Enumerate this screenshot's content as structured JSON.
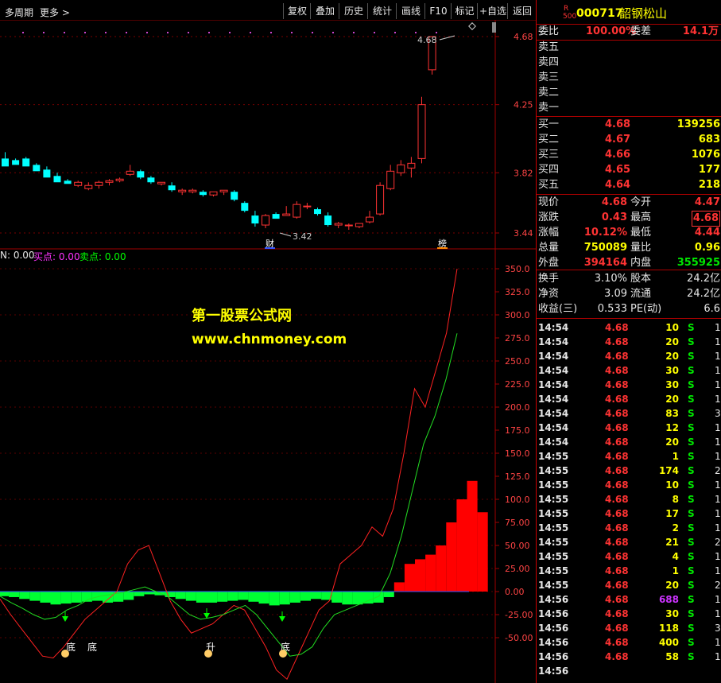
{
  "toolbar": {
    "period": "多周期",
    "more": "更多 >",
    "buttons": [
      "复权",
      "叠加",
      "历史",
      "统计",
      "画线",
      "F10",
      "标记",
      "+自选",
      "返回"
    ]
  },
  "stock": {
    "badge_top": "R",
    "badge_bottom": "500",
    "code": "000717",
    "name": "韶钢松山"
  },
  "watermark": {
    "line1": "第一股票公式网",
    "line2": "www.chnmoney.com"
  },
  "indicator_legend": {
    "n_label": "N: 0.00",
    "buy_label": "买点: 0.00",
    "sell_label": "卖点: 0.00"
  },
  "price_axis": [
    "4.68",
    "4.25",
    "3.82",
    "3.44"
  ],
  "indicator_axis": [
    "350.0",
    "325.0",
    "300.0",
    "275.0",
    "250.0",
    "225.0",
    "200.0",
    "175.0",
    "150.0",
    "125.0",
    "100.0",
    "75.00",
    "50.00",
    "25.00",
    "0.00",
    "-25.00",
    "-50.00"
  ],
  "chart_marks": {
    "high_label": "4.68",
    "low_label": "3.42",
    "cai_label": "财",
    "bang_label": "榜",
    "di1": "底",
    "di2": "底",
    "sheng": "升",
    "di3": "底"
  },
  "order_book": {
    "weibi_label": "委比",
    "weibi_value": "100.00%",
    "weicha_label": "委差",
    "weicha_value": "14.1万",
    "sells": [
      {
        "label": "卖五",
        "price": "",
        "vol": ""
      },
      {
        "label": "卖四",
        "price": "",
        "vol": ""
      },
      {
        "label": "卖三",
        "price": "",
        "vol": ""
      },
      {
        "label": "卖二",
        "price": "",
        "vol": ""
      },
      {
        "label": "卖一",
        "price": "",
        "vol": ""
      }
    ],
    "buys": [
      {
        "label": "买一",
        "price": "4.68",
        "vol": "139256"
      },
      {
        "label": "买二",
        "price": "4.67",
        "vol": "683"
      },
      {
        "label": "买三",
        "price": "4.66",
        "vol": "1076"
      },
      {
        "label": "买四",
        "price": "4.65",
        "vol": "177"
      },
      {
        "label": "买五",
        "price": "4.64",
        "vol": "218"
      }
    ]
  },
  "quote": {
    "rows": [
      {
        "l1": "现价",
        "v1": "4.68",
        "l2": "今开",
        "v2": "4.47"
      },
      {
        "l1": "涨跌",
        "v1": "0.43",
        "l2": "最高",
        "v2": "4.68"
      },
      {
        "l1": "涨幅",
        "v1": "10.12%",
        "l2": "最低",
        "v2": "4.44"
      },
      {
        "l1": "总量",
        "v1": "750089",
        "l2": "量比",
        "v2": "0.96"
      },
      {
        "l1": "外盘",
        "v1": "394164",
        "l2": "内盘",
        "v2": "355925"
      }
    ],
    "rows2": [
      {
        "l1": "换手",
        "v1": "3.10%",
        "l2": "股本",
        "v2": "24.2亿"
      },
      {
        "l1": "净资",
        "v1": "3.09",
        "l2": "流通",
        "v2": "24.2亿"
      },
      {
        "l1": "收益(三)",
        "v1": "0.533",
        "l2": "PE(动)",
        "v2": "6.6"
      }
    ]
  },
  "ticks": [
    {
      "t": "14:54",
      "p": "4.68",
      "v": "10",
      "s": "S",
      "n": "1"
    },
    {
      "t": "14:54",
      "p": "4.68",
      "v": "20",
      "s": "S",
      "n": "1"
    },
    {
      "t": "14:54",
      "p": "4.68",
      "v": "20",
      "s": "S",
      "n": "1"
    },
    {
      "t": "14:54",
      "p": "4.68",
      "v": "30",
      "s": "S",
      "n": "1"
    },
    {
      "t": "14:54",
      "p": "4.68",
      "v": "30",
      "s": "S",
      "n": "1"
    },
    {
      "t": "14:54",
      "p": "4.68",
      "v": "20",
      "s": "S",
      "n": "1"
    },
    {
      "t": "14:54",
      "p": "4.68",
      "v": "83",
      "s": "S",
      "n": "3"
    },
    {
      "t": "14:54",
      "p": "4.68",
      "v": "12",
      "s": "S",
      "n": "1"
    },
    {
      "t": "14:54",
      "p": "4.68",
      "v": "20",
      "s": "S",
      "n": "1"
    },
    {
      "t": "14:55",
      "p": "4.68",
      "v": "1",
      "s": "S",
      "n": "1"
    },
    {
      "t": "14:55",
      "p": "4.68",
      "v": "174",
      "s": "S",
      "n": "2"
    },
    {
      "t": "14:55",
      "p": "4.68",
      "v": "10",
      "s": "S",
      "n": "1"
    },
    {
      "t": "14:55",
      "p": "4.68",
      "v": "8",
      "s": "S",
      "n": "1"
    },
    {
      "t": "14:55",
      "p": "4.68",
      "v": "17",
      "s": "S",
      "n": "1"
    },
    {
      "t": "14:55",
      "p": "4.68",
      "v": "2",
      "s": "S",
      "n": "1"
    },
    {
      "t": "14:55",
      "p": "4.68",
      "v": "21",
      "s": "S",
      "n": "2"
    },
    {
      "t": "14:55",
      "p": "4.68",
      "v": "4",
      "s": "S",
      "n": "1"
    },
    {
      "t": "14:55",
      "p": "4.68",
      "v": "1",
      "s": "S",
      "n": "1"
    },
    {
      "t": "14:55",
      "p": "4.68",
      "v": "20",
      "s": "S",
      "n": "2"
    },
    {
      "t": "14:56",
      "p": "4.68",
      "v": "688",
      "s": "S",
      "n": "1"
    },
    {
      "t": "14:56",
      "p": "4.68",
      "v": "30",
      "s": "S",
      "n": "1"
    },
    {
      "t": "14:56",
      "p": "4.68",
      "v": "118",
      "s": "S",
      "n": "3"
    },
    {
      "t": "14:56",
      "p": "4.68",
      "v": "400",
      "s": "S",
      "n": "1"
    },
    {
      "t": "14:56",
      "p": "4.68",
      "v": "58",
      "s": "S",
      "n": "1"
    },
    {
      "t": "14:56",
      "p": "",
      "v": "",
      "s": "",
      "n": ""
    }
  ],
  "colors": {
    "up": "#ff3333",
    "down": "#00ffff",
    "bg": "#000000",
    "grid": "#a00000"
  },
  "chart_data": {
    "type": "candlestick",
    "candles": [
      [
        3.91,
        3.95,
        3.87,
        3.86
      ],
      [
        3.9,
        3.91,
        3.88,
        3.87
      ],
      [
        3.91,
        3.92,
        3.87,
        3.86
      ],
      [
        3.87,
        3.88,
        3.84,
        3.83
      ],
      [
        3.84,
        3.86,
        3.8,
        3.79
      ],
      [
        3.8,
        3.82,
        3.77,
        3.76
      ],
      [
        3.77,
        3.78,
        3.76,
        3.75
      ],
      [
        3.74,
        3.77,
        3.73,
        3.76
      ],
      [
        3.72,
        3.76,
        3.71,
        3.74
      ],
      [
        3.74,
        3.77,
        3.72,
        3.76
      ],
      [
        3.76,
        3.78,
        3.74,
        3.77
      ],
      [
        3.77,
        3.79,
        3.76,
        3.78
      ],
      [
        3.81,
        3.87,
        3.8,
        3.83
      ],
      [
        3.83,
        3.84,
        3.78,
        3.79
      ],
      [
        3.79,
        3.8,
        3.75,
        3.76
      ],
      [
        3.75,
        3.76,
        3.74,
        3.76
      ],
      [
        3.74,
        3.76,
        3.7,
        3.71
      ],
      [
        3.7,
        3.72,
        3.68,
        3.71
      ],
      [
        3.7,
        3.72,
        3.69,
        3.71
      ],
      [
        3.7,
        3.71,
        3.67,
        3.68
      ],
      [
        3.68,
        3.7,
        3.67,
        3.7
      ],
      [
        3.7,
        3.71,
        3.68,
        3.71
      ],
      [
        3.7,
        3.71,
        3.64,
        3.65
      ],
      [
        3.63,
        3.64,
        3.57,
        3.58
      ],
      [
        3.55,
        3.58,
        3.48,
        3.5
      ],
      [
        3.49,
        3.56,
        3.47,
        3.55
      ],
      [
        3.56,
        3.57,
        3.53,
        3.53
      ],
      [
        3.55,
        3.61,
        3.55,
        3.56
      ],
      [
        3.54,
        3.64,
        3.53,
        3.62
      ],
      [
        3.61,
        3.63,
        3.59,
        3.61
      ],
      [
        3.59,
        3.6,
        3.55,
        3.56
      ],
      [
        3.55,
        3.57,
        3.48,
        3.49
      ],
      [
        3.49,
        3.51,
        3.47,
        3.5
      ],
      [
        3.49,
        3.5,
        3.46,
        3.49
      ],
      [
        3.48,
        3.5,
        3.47,
        3.5
      ],
      [
        3.51,
        3.58,
        3.5,
        3.54
      ],
      [
        3.56,
        3.76,
        3.55,
        3.74
      ],
      [
        3.72,
        3.87,
        3.71,
        3.83
      ],
      [
        3.82,
        3.9,
        3.8,
        3.87
      ],
      [
        3.85,
        3.92,
        3.79,
        3.88
      ],
      [
        3.91,
        4.3,
        3.88,
        4.25
      ],
      [
        4.47,
        4.68,
        4.44,
        4.68
      ]
    ],
    "indicator": {
      "bars": [
        -5,
        -6,
        -8,
        -10,
        -12,
        -14,
        -13,
        -12,
        -11,
        -10,
        -12,
        -11,
        -9,
        -5,
        -3,
        -4,
        -6,
        -8,
        -10,
        -12,
        -12,
        -11,
        -10,
        -9,
        -11,
        -13,
        -15,
        -14,
        -12,
        -10,
        -8,
        -9,
        -12,
        -14,
        -14,
        -13,
        -12,
        -6,
        10,
        30,
        35,
        40,
        50,
        75,
        100,
        120,
        86
      ],
      "red_line": [
        -8,
        -25,
        -40,
        -55,
        -70,
        -72,
        -60,
        -45,
        -30,
        -20,
        -10,
        0,
        30,
        45,
        50,
        20,
        -10,
        -30,
        -45,
        -40,
        -35,
        -25,
        -15,
        -20,
        -40,
        -60,
        -85,
        -95,
        -70,
        -45,
        -20,
        -10,
        30,
        40,
        50,
        70,
        60,
        90,
        150,
        220,
        200,
        240,
        280,
        350
      ],
      "green_line": [
        -5,
        -12,
        -18,
        -25,
        -30,
        -28,
        -20,
        -15,
        -8,
        -5,
        -3,
        -1,
        2,
        5,
        0,
        -5,
        -15,
        -25,
        -30,
        -28,
        -25,
        -20,
        -15,
        -25,
        -40,
        -55,
        -70,
        -68,
        -60,
        -40,
        -25,
        -20,
        -15,
        -10,
        -5,
        20,
        60,
        110,
        160,
        190,
        230,
        280
      ],
      "ylim": [
        -50,
        350
      ]
    }
  }
}
